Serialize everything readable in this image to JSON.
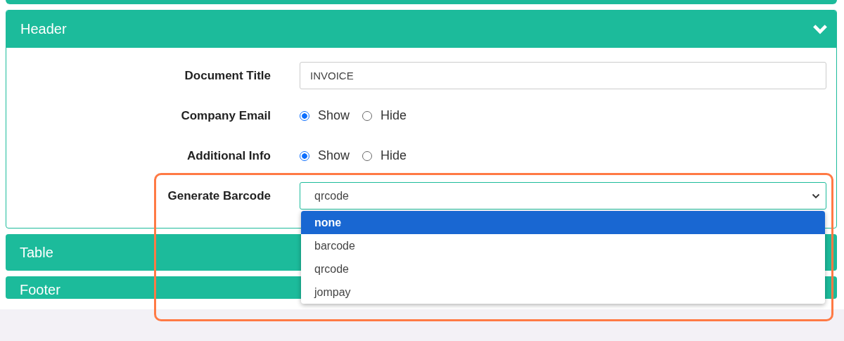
{
  "header_panel": {
    "title": "Header",
    "expanded": true,
    "fields": [
      {
        "kind": "text",
        "label": "Document Title",
        "value": "INVOICE"
      },
      {
        "kind": "radio",
        "label": "Company Email",
        "options": [
          {
            "label": "Show",
            "selected": true
          },
          {
            "label": "Hide",
            "selected": false
          }
        ]
      },
      {
        "kind": "radio",
        "label": "Additional Info",
        "options": [
          {
            "label": "Show",
            "selected": true
          },
          {
            "label": "Hide",
            "selected": false
          }
        ]
      },
      {
        "kind": "select",
        "label": "Generate Barcode",
        "value": "qrcode",
        "open": true,
        "options": [
          {
            "label": "none",
            "highlighted": true
          },
          {
            "label": "barcode",
            "highlighted": false
          },
          {
            "label": "qrcode",
            "highlighted": false
          },
          {
            "label": "jompay",
            "highlighted": false
          }
        ]
      }
    ]
  },
  "collapsed_panels": [
    {
      "title": "Table"
    },
    {
      "title": "Footer"
    }
  ]
}
